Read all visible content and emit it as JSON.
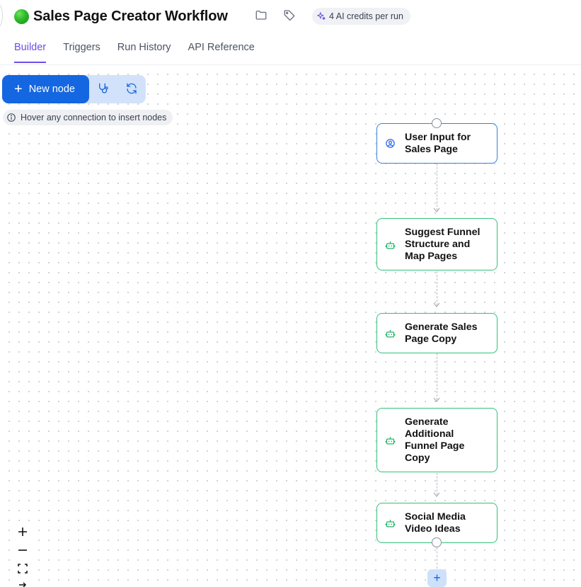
{
  "header": {
    "title": "Sales Page Creator Workflow",
    "credits": "4 AI credits per run",
    "folder_icon": "folder-icon",
    "tag_icon": "tag-icon"
  },
  "tabs": [
    {
      "label": "Builder",
      "active": true
    },
    {
      "label": "Triggers",
      "active": false
    },
    {
      "label": "Run History",
      "active": false
    },
    {
      "label": "API Reference",
      "active": false
    }
  ],
  "toolbar": {
    "new_node_label": "New node",
    "hint": "Hover any connection to insert nodes"
  },
  "nodes": [
    {
      "label_lines": [
        "User Input for",
        "Sales Page"
      ],
      "type": "input",
      "icon": "user-circle-icon"
    },
    {
      "label_lines": [
        "Suggest Funnel",
        "Structure and",
        "Map Pages"
      ],
      "type": "ai",
      "icon": "robot-icon"
    },
    {
      "label_lines": [
        "Generate Sales",
        "Page Copy"
      ],
      "type": "ai",
      "icon": "robot-icon"
    },
    {
      "label_lines": [
        "Generate",
        "Additional",
        "Funnel Page",
        "Copy"
      ],
      "type": "ai",
      "icon": "robot-icon"
    },
    {
      "label_lines": [
        "Social Media",
        "Video Ideas"
      ],
      "type": "ai",
      "icon": "robot-icon"
    }
  ],
  "colors": {
    "accent": "#6d4ee8",
    "primary_button": "#1467e0",
    "ai_node_border": "#33c07a",
    "input_node_border": "#3b7ddd"
  }
}
